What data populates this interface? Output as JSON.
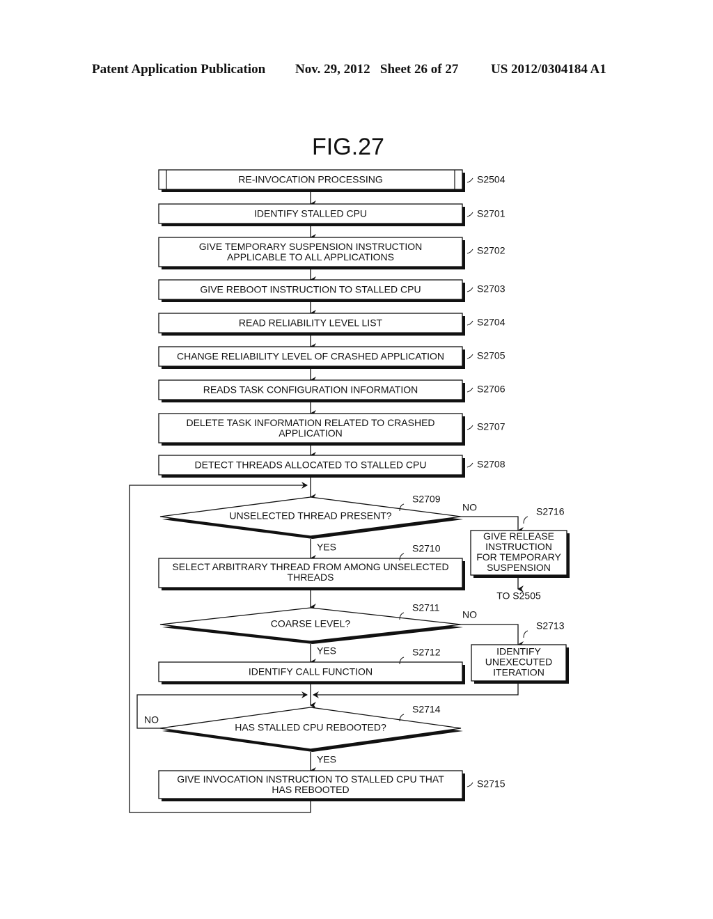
{
  "header": {
    "publication": "Patent Application Publication",
    "date_sheet": "Nov. 29, 2012   Sheet 26 of 27",
    "patent_number": "US 2012/0304184 A1"
  },
  "figure": {
    "title": "FIG.27"
  },
  "steps": {
    "s2504": {
      "id": "S2504",
      "type": "subroutine",
      "lines": [
        "RE-INVOCATION PROCESSING"
      ]
    },
    "s2701": {
      "id": "S2701",
      "type": "process",
      "lines": [
        "IDENTIFY STALLED CPU"
      ]
    },
    "s2702": {
      "id": "S2702",
      "type": "process",
      "lines": [
        "GIVE TEMPORARY SUSPENSION INSTRUCTION",
        "APPLICABLE TO ALL APPLICATIONS"
      ]
    },
    "s2703": {
      "id": "S2703",
      "type": "process",
      "lines": [
        "GIVE REBOOT INSTRUCTION TO STALLED CPU"
      ]
    },
    "s2704": {
      "id": "S2704",
      "type": "process",
      "lines": [
        "READ RELIABILITY LEVEL LIST"
      ]
    },
    "s2705": {
      "id": "S2705",
      "type": "process",
      "lines": [
        "CHANGE RELIABILITY LEVEL OF CRASHED APPLICATION"
      ]
    },
    "s2706": {
      "id": "S2706",
      "type": "process",
      "lines": [
        "READS TASK CONFIGURATION INFORMATION"
      ]
    },
    "s2707": {
      "id": "S2707",
      "type": "process",
      "lines": [
        "DELETE TASK INFORMATION RELATED TO CRASHED",
        "APPLICATION"
      ]
    },
    "s2708": {
      "id": "S2708",
      "type": "process",
      "lines": [
        "DETECT THREADS ALLOCATED TO STALLED CPU"
      ]
    },
    "s2709": {
      "id": "S2709",
      "type": "decision",
      "lines": [
        "UNSELECTED THREAD PRESENT?"
      ]
    },
    "s2710": {
      "id": "S2710",
      "type": "process",
      "lines": [
        "SELECT ARBITRARY THREAD FROM AMONG UNSELECTED",
        "THREADS"
      ]
    },
    "s2711": {
      "id": "S2711",
      "type": "decision",
      "lines": [
        "COARSE LEVEL?"
      ]
    },
    "s2712": {
      "id": "S2712",
      "type": "process",
      "lines": [
        "IDENTIFY CALL FUNCTION"
      ]
    },
    "s2713": {
      "id": "S2713",
      "type": "process",
      "lines": [
        "IDENTIFY",
        "UNEXECUTED",
        "ITERATION"
      ]
    },
    "s2714": {
      "id": "S2714",
      "type": "decision",
      "lines": [
        "HAS STALLED CPU REBOOTED?"
      ]
    },
    "s2715": {
      "id": "S2715",
      "type": "process",
      "lines": [
        "GIVE INVOCATION INSTRUCTION TO STALLED CPU THAT",
        "HAS REBOOTED"
      ]
    },
    "s2716": {
      "id": "S2716",
      "type": "process",
      "lines": [
        "GIVE RELEASE",
        "INSTRUCTION",
        "FOR TEMPORARY",
        "SUSPENSION"
      ]
    }
  },
  "branch_labels": {
    "yes": "YES",
    "no": "NO"
  },
  "connectors": {
    "to_s2505": "TO S2505"
  }
}
